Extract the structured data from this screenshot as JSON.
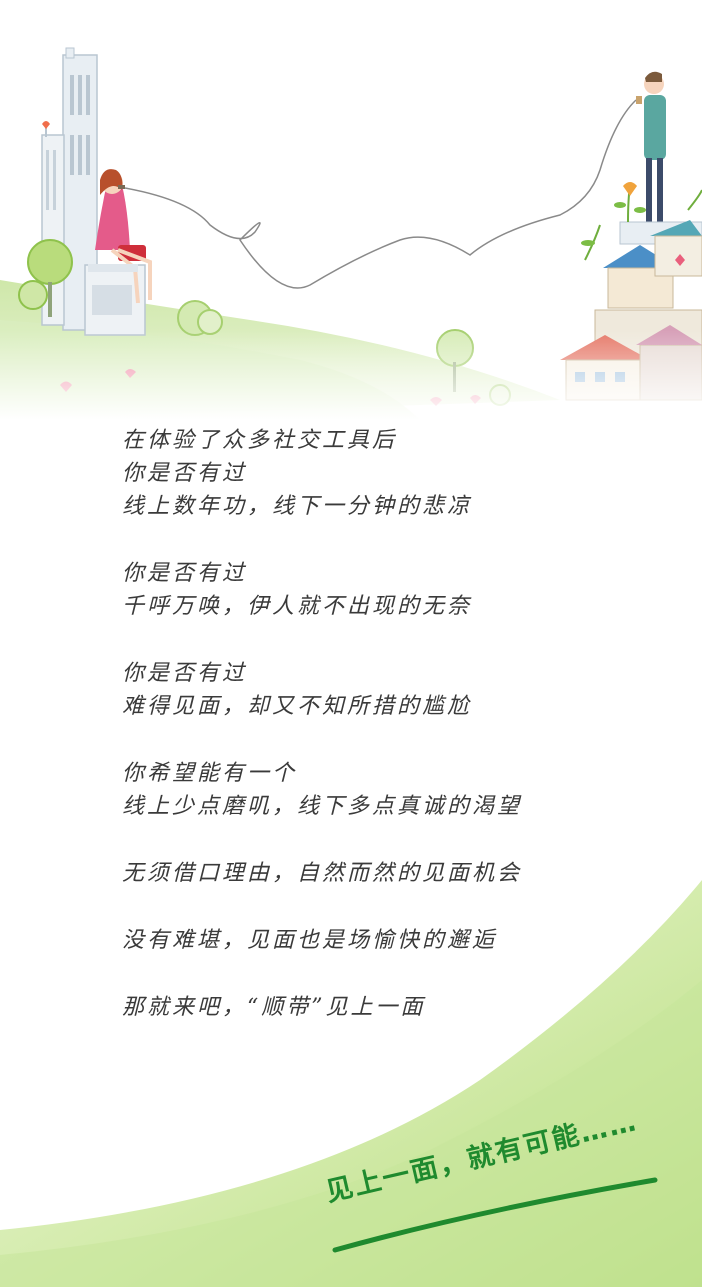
{
  "poem": {
    "stanzas": [
      [
        "在体验了众多社交工具后",
        "你是否有过",
        "线上数年功，线下一分钟的悲凉"
      ],
      [
        "你是否有过",
        "千呼万唤，伊人就不出现的无奈"
      ],
      [
        "你是否有过",
        "难得见面，却又不知所措的尴尬"
      ],
      [
        "你希望能有一个",
        "线上少点磨叽，线下多点真诚的渴望"
      ],
      [
        "无须借口理由，自然而然的见面机会"
      ],
      [
        "没有难堪，见面也是场愉快的邂逅"
      ],
      [
        "那就来吧，“顺带”见上一面"
      ]
    ]
  },
  "slogan": "见上一面，就有可能……",
  "colors": {
    "green_dark": "#1f8a2e",
    "green_light": "#c9e79a",
    "text": "#3a3a3a"
  }
}
